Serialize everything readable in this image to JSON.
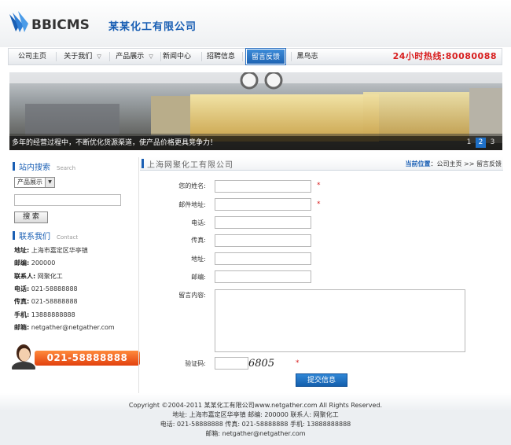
{
  "header": {
    "logo_text": "BBICMS",
    "company_name": "某某化工有限公司",
    "hotline": "24小时热线:80080088"
  },
  "nav": {
    "items": [
      {
        "label": "公司主页",
        "has_dropdown": false
      },
      {
        "label": "关于我们",
        "has_dropdown": true
      },
      {
        "label": "产品展示",
        "has_dropdown": true
      },
      {
        "label": "新闻中心",
        "has_dropdown": false
      },
      {
        "label": "招聘信息",
        "has_dropdown": false
      },
      {
        "label": "留言反馈",
        "has_dropdown": false,
        "active": true
      },
      {
        "label": "黑鸟志",
        "has_dropdown": false
      }
    ],
    "dropdown_icon": "chevron-down-icon"
  },
  "banner": {
    "caption": "多年的经营过程中，不断优化货源渠道，使产品价格更具竞争力！",
    "pages": [
      "1",
      "2",
      "3"
    ],
    "active_page": "2"
  },
  "sidebar": {
    "search": {
      "title": "站内搜索",
      "title_en": "Search",
      "select_value": "产品展示",
      "button_label": "搜 索"
    },
    "contact": {
      "title": "联系我们",
      "title_en": "Contact",
      "lines": [
        {
          "label": "地址:",
          "value": "上海市嘉定区华亭镇"
        },
        {
          "label": "邮编:",
          "value": "200000"
        },
        {
          "label": "联系人:",
          "value": "网聚化工"
        },
        {
          "label": "电话:",
          "value": "021-58888888"
        },
        {
          "label": "传真:",
          "value": "021-58888888"
        },
        {
          "label": "手机:",
          "value": "13888888888"
        },
        {
          "label": "邮箱:",
          "value": "netgather@netgather.com"
        }
      ]
    },
    "ad_phone": "021-58888888"
  },
  "main": {
    "title": "上海网聚化工有限公司",
    "breadcrumb": {
      "label": "当前位置",
      "sep": "：",
      "home": "公司主页",
      "arrow": ">>",
      "current": "留言反馈"
    },
    "form": {
      "fields": [
        {
          "label": "您的姓名:",
          "required": true
        },
        {
          "label": "邮件地址:",
          "required": true
        },
        {
          "label": "电话:",
          "required": false
        },
        {
          "label": "传真:",
          "required": false
        },
        {
          "label": "地址:",
          "required": false
        },
        {
          "label": "邮编:",
          "required": false
        }
      ],
      "message_label": "留言内容:",
      "code_label": "验证码:",
      "captcha_text": "6805",
      "required_mark": "*",
      "submit_label": "提交信息"
    }
  },
  "footer": {
    "line1": "Copyright ©2004-2011 某某化工有限公司www.netgather.com All Rights Reserved.",
    "line2": "地址: 上海市嘉定区华亭镇    邮编: 200000    联系人: 网聚化工",
    "line3": "电话: 021-58888888    传真: 021-58888888    手机: 13888888888",
    "line4": "邮箱: netgather@netgather.com"
  },
  "colors": {
    "brand_blue": "#1a5fb4",
    "hotline_red": "#d81e1e",
    "ad_orange": "#f26a21"
  }
}
